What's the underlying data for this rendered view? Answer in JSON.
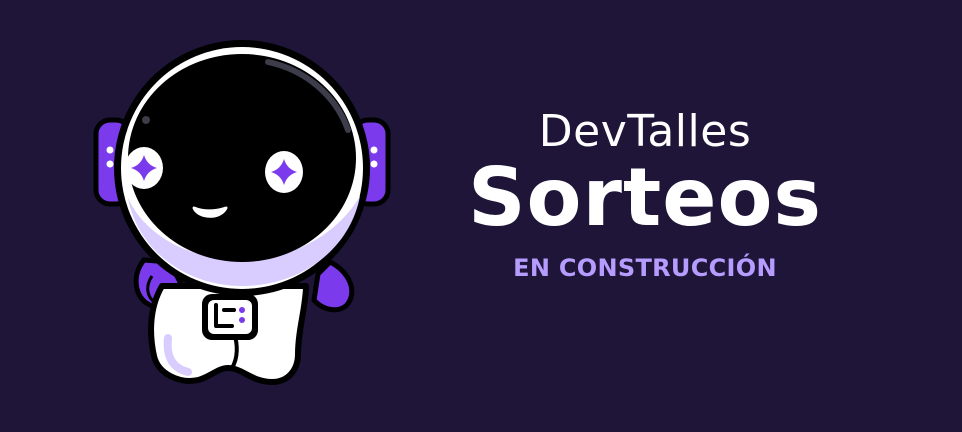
{
  "brand": {
    "name": "DevTalles",
    "title": "Sorteos",
    "status": "EN CONSTRUCCIÓN"
  },
  "mascot": {
    "icon": "astronaut-mascot-icon",
    "badge_icon": "devtalles-logo-icon"
  },
  "colors": {
    "background": "#1e1538",
    "accent": "#7c3aed",
    "status_text": "#b69cff",
    "text": "#ffffff"
  }
}
